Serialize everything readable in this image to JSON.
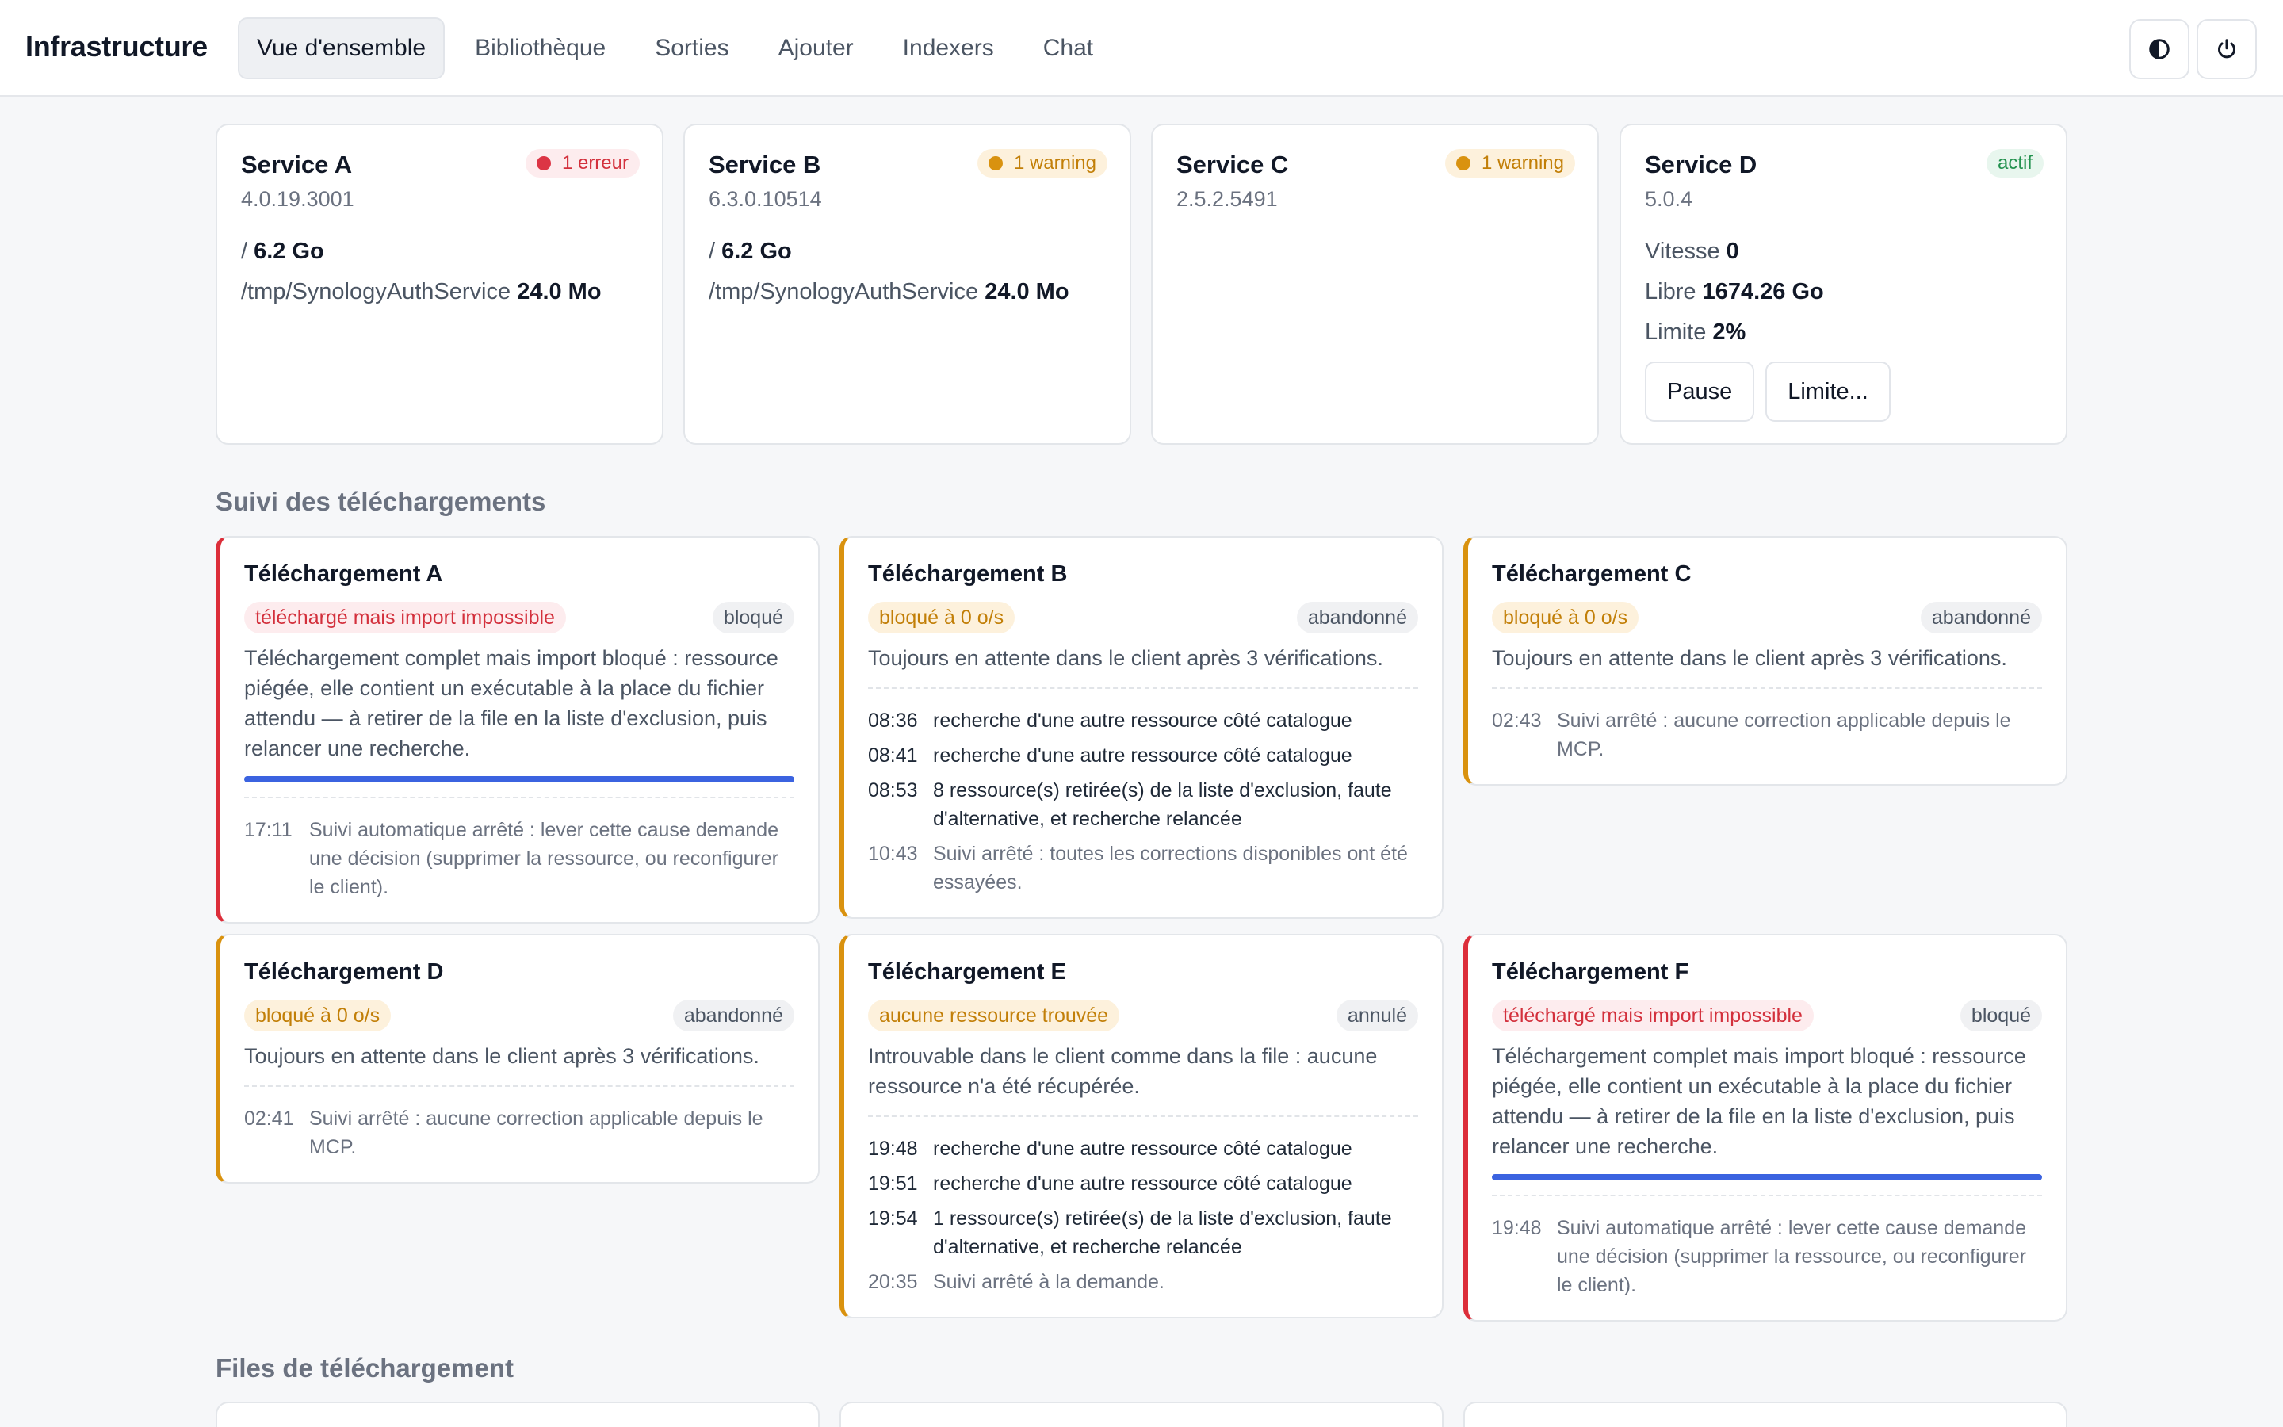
{
  "app": {
    "title": "Infrastructure"
  },
  "nav": {
    "items": [
      {
        "label": "Vue d'ensemble",
        "active": true
      },
      {
        "label": "Bibliothèque"
      },
      {
        "label": "Sorties"
      },
      {
        "label": "Ajouter"
      },
      {
        "label": "Indexers"
      },
      {
        "label": "Chat"
      }
    ]
  },
  "header_actions": {
    "theme_icon": "contrast-icon",
    "power_icon": "power-icon"
  },
  "services": [
    {
      "name": "Service A",
      "version": "4.0.19.3001",
      "badge": {
        "label": "1 erreur",
        "color": "#dc3545",
        "text_color": "#d3303c"
      },
      "lines": [
        {
          "label": "/",
          "value": "6.2 Go"
        },
        {
          "label": "/tmp/SynologyAuthService",
          "value": "24.0 Mo"
        }
      ]
    },
    {
      "name": "Service B",
      "version": "6.3.0.10514",
      "badge": {
        "label": "1 warning",
        "color": "#d9920f",
        "text_color": "#c27f08"
      },
      "lines": [
        {
          "label": "/",
          "value": "6.2 Go"
        },
        {
          "label": "/tmp/SynologyAuthService",
          "value": "24.0 Mo"
        }
      ]
    },
    {
      "name": "Service C",
      "version": "2.5.2.5491",
      "badge": {
        "label": "1 warning",
        "color": "#d9920f",
        "text_color": "#c27f08"
      },
      "lines": []
    },
    {
      "name": "Service D",
      "version": "5.0.4",
      "badge": {
        "label": "actif",
        "color": "#e8f6ee",
        "text_color": "#23924f"
      },
      "lines": [
        {
          "label": "Vitesse",
          "value": "0"
        },
        {
          "label": "Libre",
          "value": "1674.26 Go"
        },
        {
          "label": "Limite",
          "value": "2%"
        }
      ],
      "buttons": {
        "pause": "Pause",
        "limit": "Limite..."
      }
    }
  ],
  "sections": {
    "tracking": "Suivi des téléchargements",
    "queues": "Files de téléchargement"
  },
  "downloads": [
    {
      "title": "Téléchargement A",
      "severity": "red",
      "reason": "téléchargé mais import impossible",
      "state": "bloqué",
      "description": "Téléchargement complet mais import bloqué : ressource piégée, elle contient un exécutable à la place du fichier attendu — à retirer de la file en la liste d'exclusion, puis relancer une recherche.",
      "progress": 1.0,
      "events": [
        {
          "time": "17:11",
          "text": "Suivi automatique arrêté : lever cette cause demande une décision (supprimer la ressource, ou reconfigurer le client).",
          "dim": true
        }
      ]
    },
    {
      "title": "Téléchargement B",
      "severity": "amber",
      "reason": "bloqué à 0 o/s",
      "state": "abandonné",
      "description": "Toujours en attente dans le client après 3 vérifications.",
      "events": [
        {
          "time": "08:36",
          "text": "recherche d'une autre ressource côté catalogue",
          "dim": false
        },
        {
          "time": "08:41",
          "text": "recherche d'une autre ressource côté catalogue",
          "dim": false
        },
        {
          "time": "08:53",
          "text": "8 ressource(s) retirée(s) de la liste d'exclusion, faute d'alternative, et recherche relancée",
          "dim": false
        },
        {
          "time": "10:43",
          "text": "Suivi arrêté : toutes les corrections disponibles ont été essayées.",
          "dim": true
        }
      ]
    },
    {
      "title": "Téléchargement C",
      "severity": "amber",
      "reason": "bloqué à 0 o/s",
      "state": "abandonné",
      "description": "Toujours en attente dans le client après 3 vérifications.",
      "events": [
        {
          "time": "02:43",
          "text": "Suivi arrêté : aucune correction applicable depuis le MCP.",
          "dim": true
        }
      ]
    },
    {
      "title": "Téléchargement D",
      "severity": "amber",
      "reason": "bloqué à 0 o/s",
      "state": "abandonné",
      "description": "Toujours en attente dans le client après 3 vérifications.",
      "events": [
        {
          "time": "02:41",
          "text": "Suivi arrêté : aucune correction applicable depuis le MCP.",
          "dim": true
        }
      ]
    },
    {
      "title": "Téléchargement E",
      "severity": "amber",
      "reason": "aucune ressource trouvée",
      "state": "annulé",
      "description": "Introuvable dans le client comme dans la file : aucune ressource n'a été récupérée.",
      "events": [
        {
          "time": "19:48",
          "text": "recherche d'une autre ressource côté catalogue",
          "dim": false
        },
        {
          "time": "19:51",
          "text": "recherche d'une autre ressource côté catalogue",
          "dim": false
        },
        {
          "time": "19:54",
          "text": "1 ressource(s) retirée(s) de la liste d'exclusion, faute d'alternative, et recherche relancée",
          "dim": false
        },
        {
          "time": "20:35",
          "text": "Suivi arrêté à la demande.",
          "dim": true
        }
      ]
    },
    {
      "title": "Téléchargement F",
      "severity": "red",
      "reason": "téléchargé mais import impossible",
      "state": "bloqué",
      "description": "Téléchargement complet mais import bloqué : ressource piégée, elle contient un exécutable à la place du fichier attendu — à retirer de la file en la liste d'exclusion, puis relancer une recherche.",
      "progress": 1.0,
      "events": [
        {
          "time": "19:48",
          "text": "Suivi automatique arrêté : lever cette cause demande une décision (supprimer la ressource, ou reconfigurer le client).",
          "dim": true
        }
      ]
    }
  ]
}
